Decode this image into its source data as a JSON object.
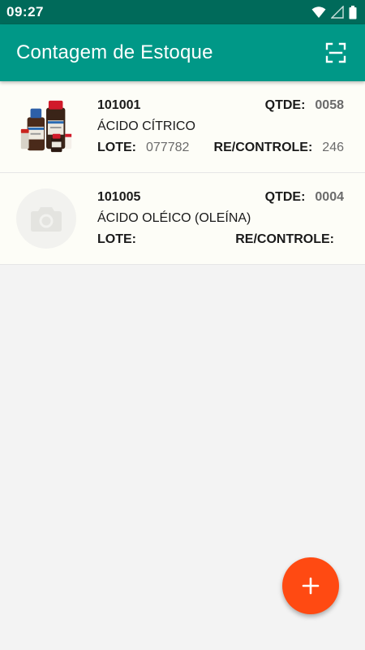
{
  "status_bar": {
    "time": "09:27",
    "icons": [
      "wifi-icon",
      "signal-icon",
      "battery-icon"
    ]
  },
  "app_bar": {
    "title": "Contagem de Estoque",
    "action_icon": "scan-icon"
  },
  "colors": {
    "status_bar": "#006a5a",
    "app_bar": "#009887",
    "fab": "#ff4a12",
    "card": "#fdfdf7",
    "background": "#f3f3f3"
  },
  "items": [
    {
      "code": "101001",
      "qty_label": "QTDE:",
      "qty": "0058",
      "name": "ÁCIDO CÍTRICO",
      "lote_label": "LOTE:",
      "lote": "077782",
      "control_label": "RE/CONTROLE:",
      "control": "246",
      "image": "product-bottles"
    },
    {
      "code": "101005",
      "qty_label": "QTDE:",
      "qty": "0004",
      "name": "ÁCIDO OLÉICO (OLEÍNA)",
      "lote_label": "LOTE:",
      "lote": "",
      "control_label": "RE/CONTROLE:",
      "control": "",
      "image": "camera-placeholder"
    }
  ],
  "fab": {
    "icon": "plus-icon"
  }
}
